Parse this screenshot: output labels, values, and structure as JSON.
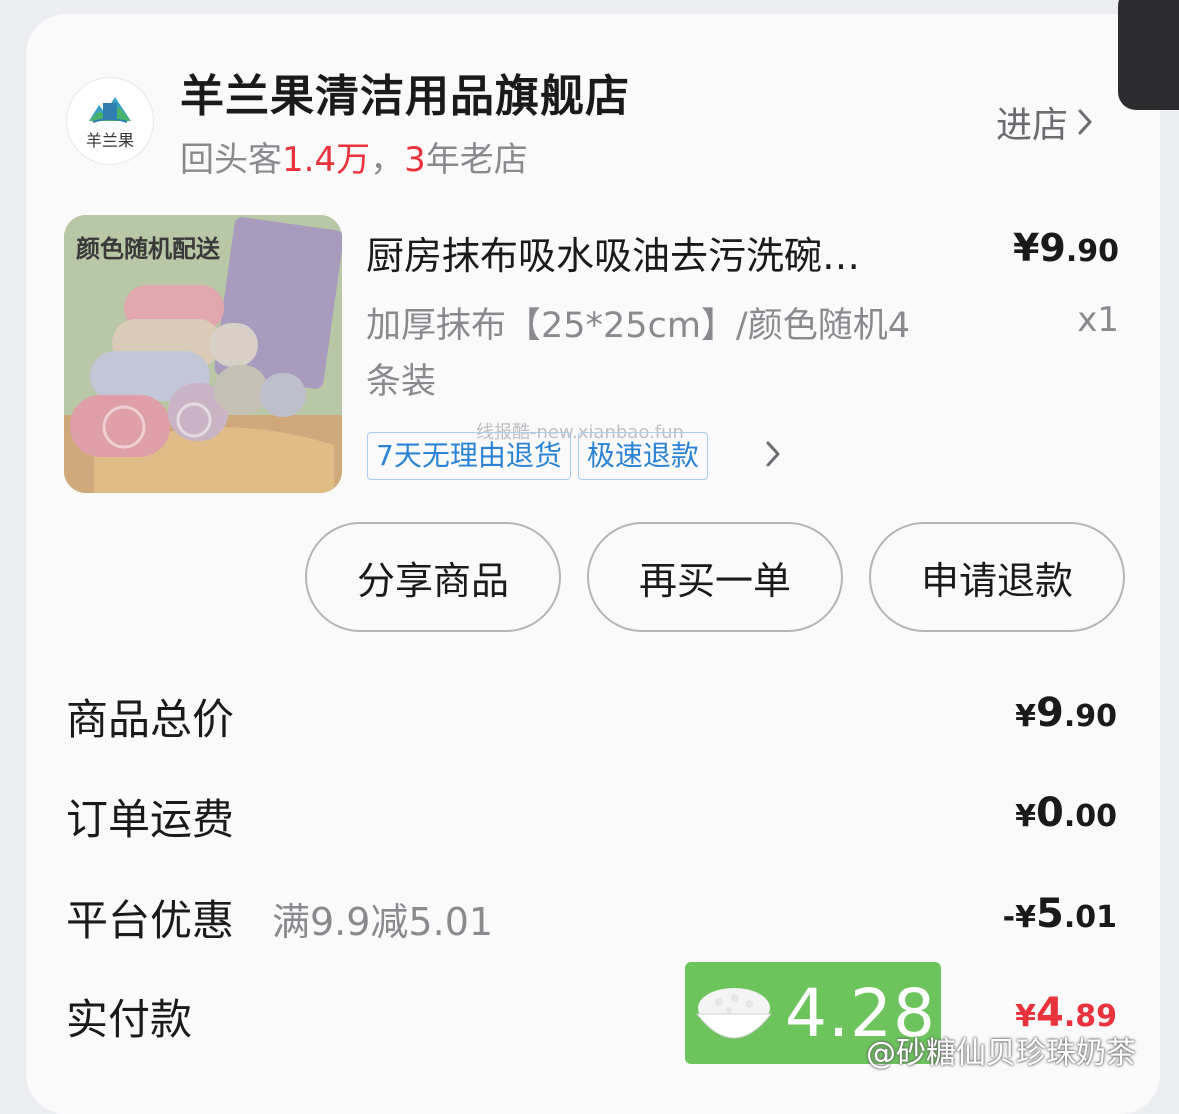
{
  "shop": {
    "logo_text": "羊兰果",
    "name": "羊兰果清洁用品旗舰店",
    "meta_prefix": "回头客",
    "repeat_customers": "1.4万",
    "meta_sep": "，",
    "years": "3",
    "years_suffix": "年老店",
    "enter_label": "进店"
  },
  "product": {
    "image_caption": "颜色随机配送",
    "title": "厨房抹布吸水吸油去污洗碗…",
    "price_main": "¥9",
    "price_decimal": ".90",
    "spec": "加厚抹布【25*25cm】/颜色随机4条装",
    "quantity": "x1",
    "tags": [
      "7天无理由退货",
      "极速退款"
    ]
  },
  "watermark": "线报酷-new.xianbao.fun",
  "actions": {
    "share": "分享商品",
    "rebuy": "再买一单",
    "refund": "申请退款"
  },
  "summary": {
    "goods_total": {
      "label": "商品总价",
      "cur": "¥",
      "int": "9",
      "dec": ".90"
    },
    "shipping": {
      "label": "订单运费",
      "cur": "¥",
      "int": "0",
      "dec": ".00"
    },
    "discount": {
      "label": "平台优惠",
      "note": "满9.9减5.01",
      "cur": "-¥",
      "int": "5",
      "dec": ".01"
    },
    "paid": {
      "label": "实付款",
      "cur": "¥",
      "int": "4",
      "dec": ".89"
    }
  },
  "sticker": {
    "value": "4.28"
  },
  "credit": "@砂糖仙贝珍珠奶茶",
  "colors": {
    "accent_red": "#e8323c",
    "tag_blue": "#2b83d6",
    "sticker_green": "#6dc45d"
  }
}
